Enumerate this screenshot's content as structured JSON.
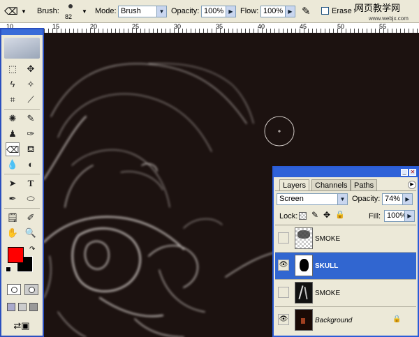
{
  "options_bar": {
    "brush_label": "Brush:",
    "brush_size": "82",
    "mode_label": "Mode:",
    "mode_value": "Brush",
    "opacity_label": "Opacity:",
    "opacity_value": "100%",
    "flow_label": "Flow:",
    "flow_value": "100%",
    "erase_label": "Erase to Hi",
    "watermark": "网页教学网",
    "watermark_url": "www.webjx.com"
  },
  "ruler": {
    "left_label": "10",
    "marks": [
      "15",
      "20",
      "25",
      "30",
      "35",
      "40",
      "45",
      "50",
      "55"
    ]
  },
  "layers_panel": {
    "tabs": [
      "Layers",
      "Channels",
      "Paths"
    ],
    "blend_mode": "Screen",
    "opacity_label": "Opacity:",
    "opacity_value": "74%",
    "lock_label": "Lock:",
    "fill_label": "Fill:",
    "fill_value": "100%",
    "layers": [
      {
        "name": "SMOKE",
        "visible": false,
        "selected": false
      },
      {
        "name": "SKULL",
        "visible": true,
        "selected": true
      },
      {
        "name": "SMOKE",
        "visible": false,
        "selected": false
      },
      {
        "name": "Background",
        "visible": true,
        "selected": false,
        "locked": true
      }
    ]
  },
  "colors": {
    "foreground": "#ff0000",
    "background": "#000000",
    "selection": "#3166d0"
  }
}
